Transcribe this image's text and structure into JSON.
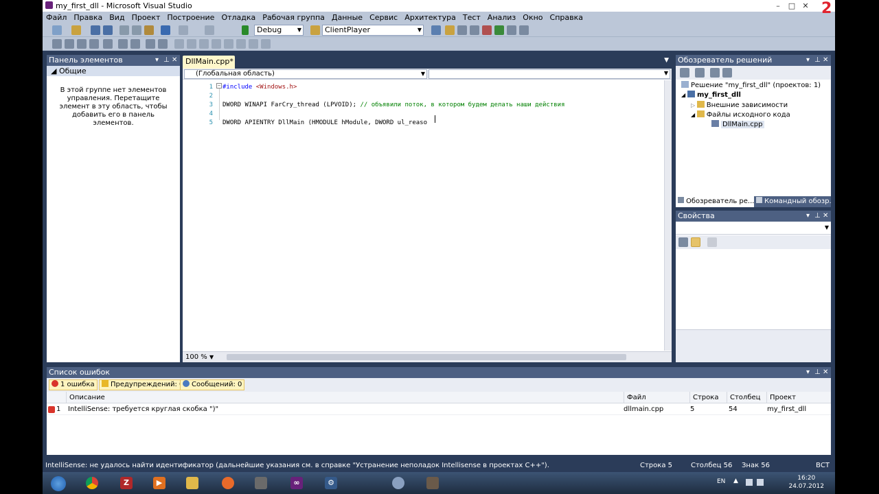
{
  "window": {
    "title": "my_first_dll - Microsoft Visual Studio",
    "minimize": "–",
    "maximize": "□",
    "close": "✕"
  },
  "menu": [
    "Файл",
    "Правка",
    "Вид",
    "Проект",
    "Построение",
    "Отладка",
    "Рабочая группа",
    "Данные",
    "Сервис",
    "Архитектура",
    "Тест",
    "Анализ",
    "Окно",
    "Справка"
  ],
  "toolbar": {
    "config": "Debug",
    "project": "ClientPlayer"
  },
  "toolbox": {
    "title": "Панель элементов",
    "group": "◢ Общие",
    "empty_text": "В этой группе нет элементов управления. Перетащите элемент в эту область, чтобы добавить его в панель элементов."
  },
  "editor": {
    "tab": "DllMain.cpp*",
    "scope": "(Глобальная область)",
    "zoom": "100 %",
    "lines": [
      {
        "num": "1",
        "parts": [
          {
            "t": "#include ",
            "c": "kw"
          },
          {
            "t": "<Windows.h>",
            "c": "str"
          }
        ]
      },
      {
        "num": "2",
        "parts": []
      },
      {
        "num": "3",
        "parts": [
          {
            "t": "DWORD WINAPI FarCry_thread (LPVOID); ",
            "c": ""
          },
          {
            "t": "// объявили поток, в котором будем делать наши действия",
            "c": "cmt"
          }
        ]
      },
      {
        "num": "4",
        "parts": []
      },
      {
        "num": "5",
        "parts": [
          {
            "t": "DWORD APIENTRY DllMain (HMODULE hModule, DWORD ul_reaso",
            "c": ""
          }
        ]
      }
    ]
  },
  "solution": {
    "title": "Обозреватель решений",
    "items": [
      {
        "label": "Решение \"my_first_dll\" (проектов: 1)",
        "bold": false
      },
      {
        "label": "my_first_dll",
        "bold": true
      },
      {
        "label": "Внешние зависимости",
        "bold": false
      },
      {
        "label": "Файлы исходного кода",
        "bold": false
      },
      {
        "label": "DllMain.cpp",
        "bold": false
      }
    ],
    "tab1": "Обозреватель ре...",
    "tab2": "Командный обозр..."
  },
  "properties": {
    "title": "Свойства"
  },
  "errors": {
    "title": "Список ошибок",
    "filter_errors": "1 ошибка",
    "filter_warnings": "Предупреждений: 0",
    "filter_messages": "Сообщений: 0",
    "columns": {
      "desc": "Описание",
      "file": "Файл",
      "line": "Строка",
      "col": "Столбец",
      "project": "Проект"
    },
    "rows": [
      {
        "num": "1",
        "desc": "IntelliSense: требуется круглая скобка \")\"",
        "file": "dllmain.cpp",
        "line": "5",
        "col": "54",
        "project": "my_first_dll"
      }
    ]
  },
  "status": {
    "message": "IntelliSense: не удалось найти идентификатор (дальнейшие указания см. в справке \"Устранение неполадок Intellisense в проектах C++\").",
    "row": "Строка 5",
    "col": "Столбец 56",
    "char": "Знак 56",
    "mode": "ВСТ"
  },
  "taskbar": {
    "lang": "EN",
    "time": "16:20",
    "date": "24.07.2012"
  },
  "corner_mark": "2"
}
